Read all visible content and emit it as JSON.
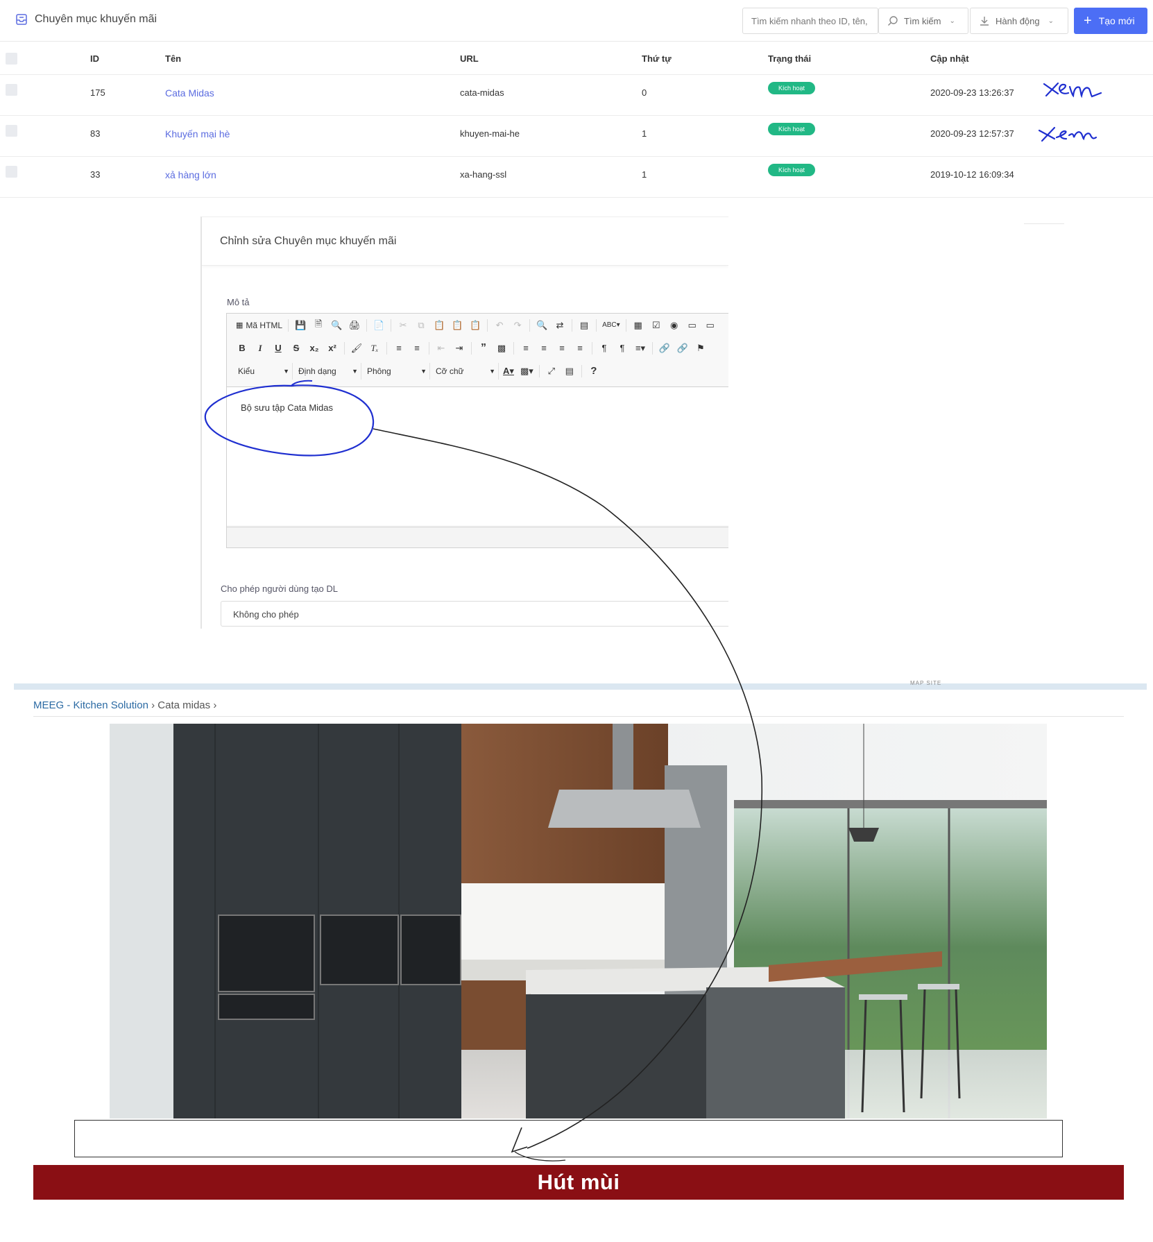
{
  "admin": {
    "page_title": "Chuyên mục khuyến mãi",
    "search_placeholder": "Tìm kiếm nhanh theo ID, tên,",
    "search_button": "Tìm kiếm",
    "action_button": "Hành động",
    "create_button": "Tạo mới",
    "columns": [
      "ID",
      "Tên",
      "URL",
      "Thứ tự",
      "Trạng thái",
      "Cập nhật"
    ],
    "rows": [
      {
        "id": "175",
        "name": "Cata Midas",
        "url": "cata-midas",
        "order": "0",
        "status": "Kích hoạt",
        "updated": "2020-09-23 13:26:37",
        "note": "xem"
      },
      {
        "id": "83",
        "name": "Khuyến mại hè",
        "url": "khuyen-mai-he",
        "order": "1",
        "status": "Kích hoạt",
        "updated": "2020-09-23 12:57:37",
        "note": "xem"
      },
      {
        "id": "33",
        "name": "xả hàng lớn",
        "url": "xa-hang-ssl",
        "order": "1",
        "status": "Kích hoạt",
        "updated": "2019-10-12 16:09:34",
        "note": ""
      }
    ],
    "colors": {
      "accent": "#4c6ef5",
      "status": "#21b885",
      "link": "#5b6ce0"
    }
  },
  "edit": {
    "title": "Chỉnh sửa Chuyên mục khuyến mãi",
    "desc_label": "Mô tả",
    "toolbar": {
      "source_label": "Mã HTML",
      "style_combo": "Kiểu",
      "format_combo": "Định dạng",
      "font_combo": "Phông",
      "size_combo": "Cỡ chữ",
      "help": "?"
    },
    "content": "Bộ sưu tập Cata Midas",
    "perm_label": "Cho phép người dùng tạo DL",
    "perm_value": "Không cho phép"
  },
  "site": {
    "band_text": "MAP SITE",
    "breadcrumb_home": "MEEG - Kitchen Solution",
    "breadcrumb_current": "Cata midas",
    "category_heading": "Hút mùi",
    "heading_color": "#8a0f14"
  }
}
